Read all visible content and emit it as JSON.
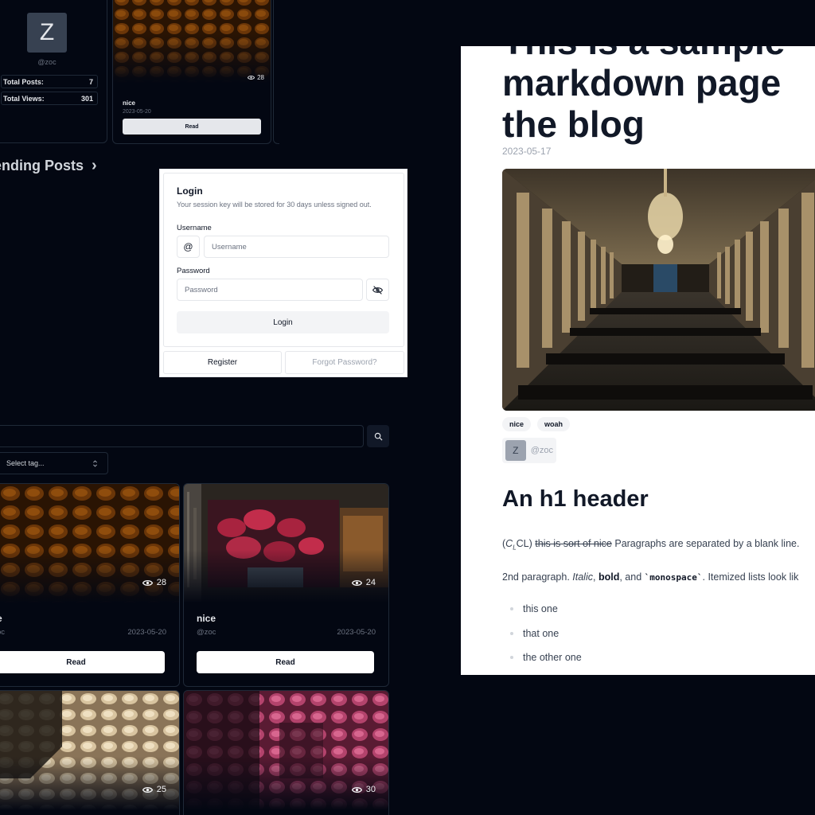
{
  "profile": {
    "avatar_letter": "Z",
    "handle": "@zoc",
    "stats": [
      {
        "label": "Total Posts:",
        "value": "7"
      },
      {
        "label": "Total Views:",
        "value": "301"
      }
    ]
  },
  "featured_post": {
    "views": "28",
    "title": "nice",
    "date": "2023-05-20",
    "read_label": "Read"
  },
  "trending": {
    "label": "ending Posts",
    "chevron": "›"
  },
  "login": {
    "title": "Login",
    "description": "Your session key will be stored for 30 days unless signed out.",
    "username_label": "Username",
    "username_prefix": "@",
    "username_placeholder": "Username",
    "password_label": "Password",
    "password_placeholder": "Password",
    "submit_label": "Login",
    "register_label": "Register",
    "forgot_label": "Forgot Password?"
  },
  "search": {
    "tag_placeholder": "Select tag..."
  },
  "posts": [
    {
      "views": "28",
      "title": "e",
      "author": "oc",
      "date": "2023-05-20",
      "read_label": "Read"
    },
    {
      "views": "24",
      "title": "nice",
      "author": "@zoc",
      "date": "2023-05-20",
      "read_label": "Read"
    },
    {
      "views": "25"
    },
    {
      "views": "30"
    }
  ],
  "article": {
    "title": "This is a sample markdown page the blog",
    "title_lines": [
      "This is a sample",
      "markdown page",
      "the blog"
    ],
    "date": "2023-05-17",
    "tags": [
      "nice",
      "woah"
    ],
    "author_letter": "Z",
    "author_handle": "@zoc",
    "h1": "An h1 header",
    "p1": {
      "open": "(",
      "math_c": "C",
      "math_sub": "L",
      "math_close": "CL)",
      "strike": "this is sort of nice",
      "rest": "Paragraphs are separated by a blank line."
    },
    "p2": {
      "start": "2nd paragraph.",
      "italic": "Italic",
      "comma": ",",
      "bold": "bold",
      "and": ", and",
      "mono": "`monospace`",
      "end": ". Itemized lists look lik"
    },
    "list": [
      "this one",
      "that one",
      "the other one"
    ]
  },
  "colors": {
    "background": "#030712",
    "card_border": "#1f2937",
    "article_bg": "#ffffff"
  }
}
